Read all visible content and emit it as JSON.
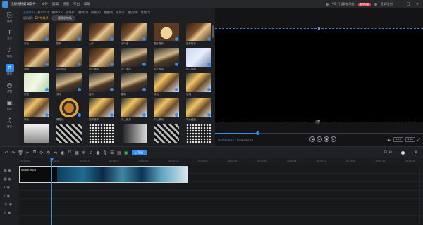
{
  "window": {
    "title": "迅捷视频剪辑软件",
    "menu": [
      "文件",
      "编辑",
      "视图",
      "导出",
      "帮助"
    ],
    "right_text": "VIP 升级解锁功能",
    "vip_badge": "限时特惠",
    "account": "登录/注册"
  },
  "sidebar": {
    "items": [
      {
        "icon": "⎘",
        "label": "素材"
      },
      {
        "icon": "T",
        "label": "文字"
      },
      {
        "icon": "♪",
        "label": "特效"
      },
      {
        "icon": "⇄",
        "label": "转场"
      },
      {
        "icon": "◎",
        "label": "滤镜"
      },
      {
        "icon": "▣",
        "label": "图片"
      },
      {
        "icon": "♫",
        "label": "音乐"
      }
    ]
  },
  "effects": {
    "tabs": [
      {
        "label": "全部(51)",
        "active": true
      },
      {
        "label": "基本(15)"
      },
      {
        "label": "擦除(15)"
      },
      {
        "label": "百叶(5)"
      },
      {
        "label": "翻转(7)"
      },
      {
        "label": "网格(9)"
      },
      {
        "label": "缩放(9)"
      },
      {
        "label": "形状(6)"
      },
      {
        "label": "翻页(4)"
      },
      {
        "label": "其他(5)"
      }
    ],
    "subtabs": {
      "first": "随机(6)",
      "active": "DIY专属(4)",
      "pill": "一键随机转场"
    },
    "items": [
      {
        "cls": "k",
        "label": "淡化"
      },
      {
        "cls": "k",
        "label": "翻开"
      },
      {
        "cls": "k",
        "label": "上升"
      },
      {
        "cls": "k",
        "label": "百叶窗"
      },
      {
        "cls": "c",
        "label": "圆形展开"
      },
      {
        "cls": "k",
        "label": "星形打开"
      },
      {
        "cls": "k",
        "label": "溶解"
      },
      {
        "cls": "k",
        "label": "向左擦除"
      },
      {
        "cls": "k",
        "label": "向右擦除"
      },
      {
        "cls": "s",
        "label": "向下擦除"
      },
      {
        "cls": "s",
        "label": "向上擦除"
      },
      {
        "cls": "b",
        "label": "进入旋转"
      },
      {
        "cls": "g",
        "label": "闪现"
      },
      {
        "cls": "s",
        "label": "滑动"
      },
      {
        "cls": "s",
        "label": "旋转"
      },
      {
        "cls": "s",
        "label": "翻转"
      },
      {
        "cls": "w",
        "label": "滚动"
      },
      {
        "cls": "w",
        "label": "涟漪"
      },
      {
        "cls": "w",
        "label": "弹出"
      },
      {
        "cls": "r",
        "label": "螺旋线"
      },
      {
        "cls": "w",
        "label": "旋转推开"
      },
      {
        "cls": "w",
        "label": "向上推开"
      },
      {
        "cls": "w",
        "label": "中心滚动"
      },
      {
        "cls": "w",
        "label": "中心缩放"
      },
      {
        "cls": "gr",
        "label": ""
      },
      {
        "cls": "ch",
        "label": ""
      },
      {
        "cls": "d",
        "label": ""
      },
      {
        "cls": "n",
        "label": ""
      },
      {
        "cls": "ch",
        "label": ""
      },
      {
        "cls": "d",
        "label": ""
      }
    ]
  },
  "preview": {
    "current_time": "00:00:00.25",
    "total_time": "00:00:40.24",
    "aspect": "16:9",
    "zoom": "1.0x"
  },
  "toolbar": {
    "export_label": "导出"
  },
  "timeline": {
    "ticks": [
      "00:00:00",
      "00:00:05",
      "00:00:10",
      "00:00:15",
      "00:00:20",
      "00:00:25",
      "00:00:30",
      "00:00:35",
      "00:00:40",
      "00:00:45",
      "00:00:50",
      "00:00:55",
      "00:01:00",
      "00:01:05"
    ],
    "clip_name": "shipin.mp4",
    "playhead_time": "00:00:00.25"
  },
  "colors": {
    "accent": "#2f8df0",
    "bg": "#1b1b1d"
  }
}
